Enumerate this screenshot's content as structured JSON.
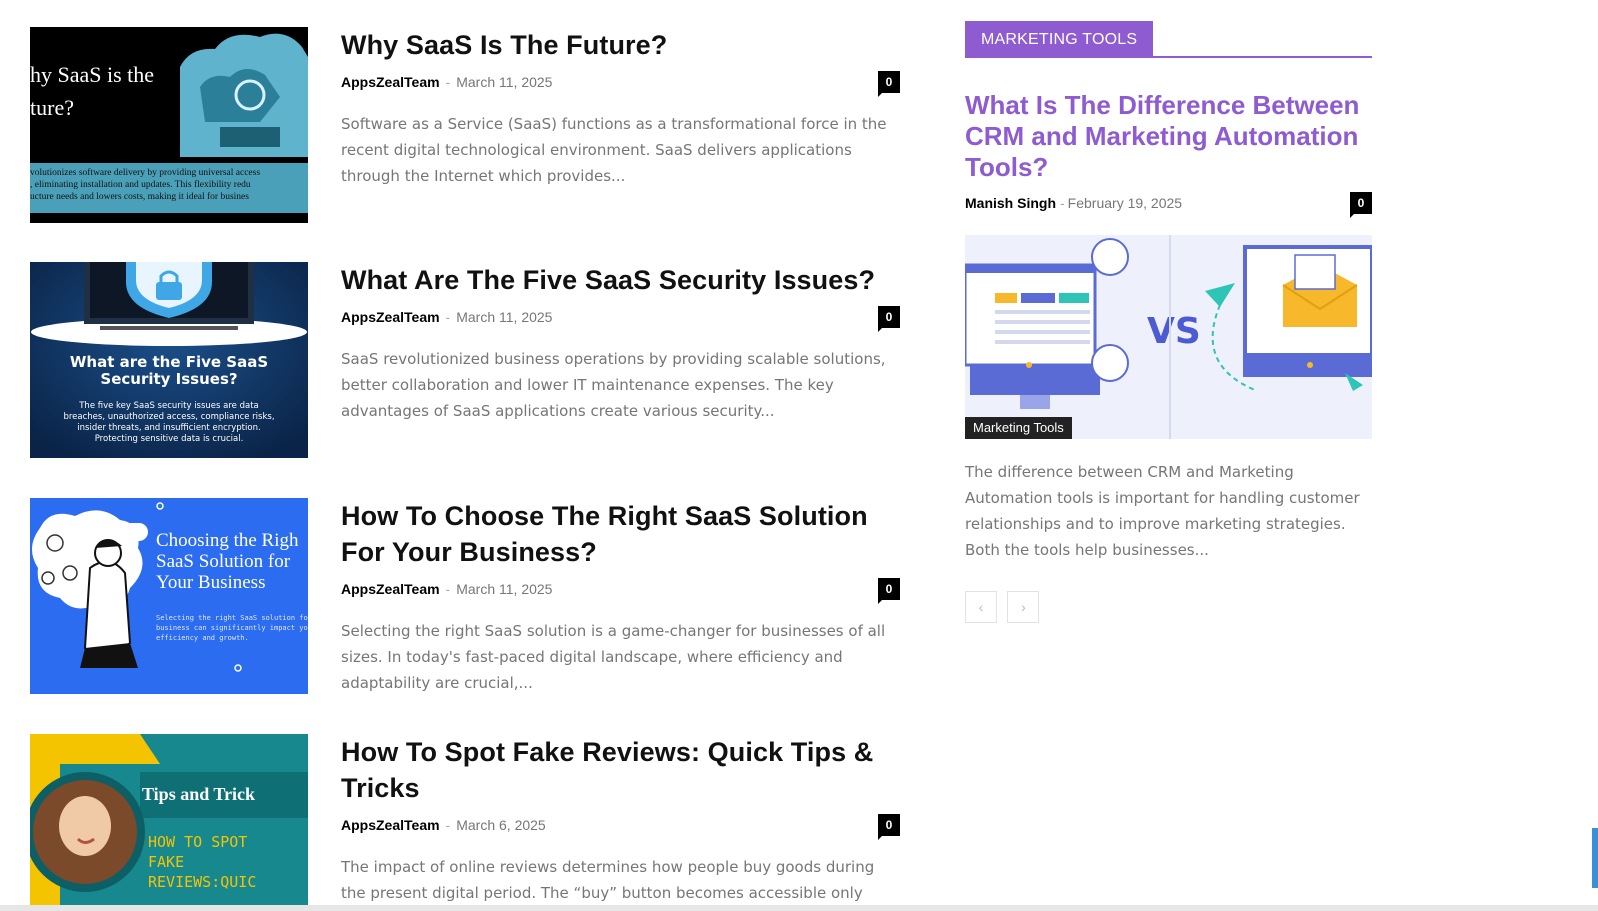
{
  "articles": [
    {
      "title": "Why SaaS Is The Future?",
      "author": "AppsZealTeam",
      "separator": "-",
      "date": "March 11, 2025",
      "comments": "0",
      "excerpt": "Software as a Service (SaaS) functions as a transformational force in the recent digital technological environment. SaaS delivers applications through the Internet which provides...",
      "thumb_text": [
        "hy SaaS is the",
        "ture?",
        "volutionizes software delivery by providing universal access",
        ", eliminating installation and updates. This flexibility redu",
        "ucture needs and lowers costs, making it ideal for busines"
      ]
    },
    {
      "title": "What Are The Five SaaS Security Issues?",
      "author": "AppsZealTeam",
      "separator": "-",
      "date": "March 11, 2025",
      "comments": "0",
      "excerpt": "SaaS revolutionized business operations by providing scalable solutions, better collaboration and lower IT maintenance expenses. The key advantages of SaaS applications create various security...",
      "thumb_text": [
        "What are the Five SaaS",
        "Security Issues?",
        "The five key SaaS security issues are data",
        "breaches, unauthorized access, compliance risks,",
        "insider threats, and insufficient encryption.",
        "Protecting sensitive data is crucial."
      ]
    },
    {
      "title": "How To Choose The Right SaaS Solution For Your Business?",
      "author": "AppsZealTeam",
      "separator": "-",
      "date": "March 11, 2025",
      "comments": "0",
      "excerpt": "Selecting the right SaaS solution is a game-changer for businesses of all sizes. In today's fast-paced digital landscape, where efficiency and adaptability are crucial,...",
      "thumb_text": [
        "Choosing the Righ",
        "SaaS Solution for",
        "Your Business",
        "Selecting the right SaaS solution for you",
        "business can significantly impact your",
        "efficiency and growth."
      ]
    },
    {
      "title": "How To Spot Fake Reviews: Quick Tips & Tricks",
      "author": "AppsZealTeam",
      "separator": "-",
      "date": "March 6, 2025",
      "comments": "0",
      "excerpt": "The impact of online reviews determines how people buy goods during the present digital period. The “buy” button becomes accessible only after",
      "thumb_text": [
        "Tips and Trick",
        "HOW TO SPOT",
        "FAKE",
        "REVIEWS:QUIC"
      ]
    }
  ],
  "widget": {
    "title": "MARKETING TOOLS",
    "featured": {
      "title": "What Is The Difference Between CRM and Marketing Automation Tools?",
      "author": "Manish Singh",
      "separator": "-",
      "date": "February 19, 2025",
      "comments": "0",
      "category": "Marketing Tools",
      "image_text": "VS",
      "excerpt": "The difference between CRM and Marketing Automation tools is important for handling customer relationships and to improve marketing strategies. Both the tools help businesses..."
    },
    "pager": {
      "prev": "‹",
      "next": "›"
    }
  },
  "colors": {
    "accent": "#8e5bd0",
    "meta_gray": "#777777",
    "excerpt_gray": "#767676"
  }
}
